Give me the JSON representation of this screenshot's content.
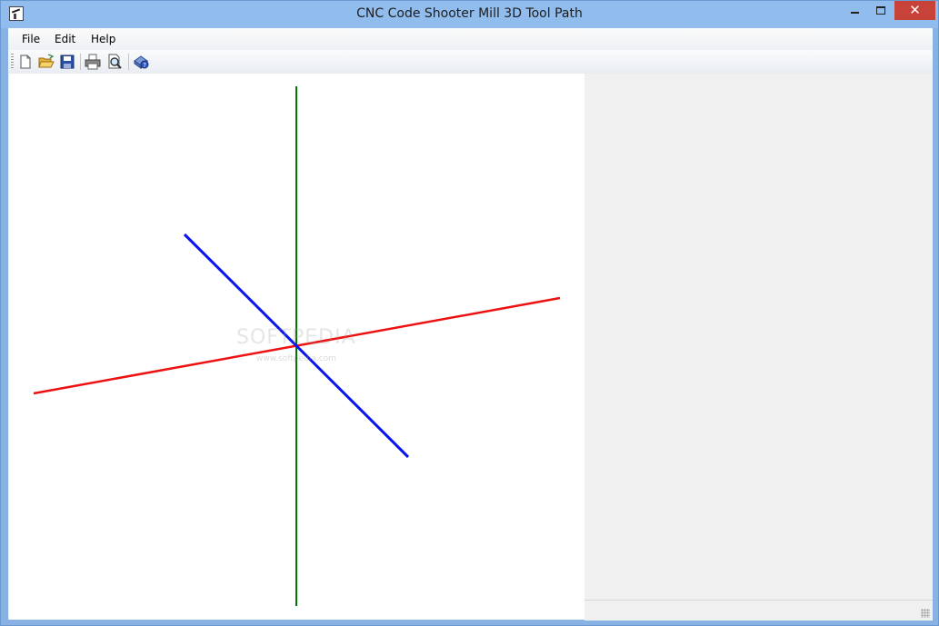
{
  "window": {
    "title": "CNC Code Shooter Mill 3D Tool Path",
    "controls": {
      "minimize": "minimize",
      "maximize": "maximize",
      "close": "✕"
    }
  },
  "menu": [
    {
      "id": "file",
      "label": "File"
    },
    {
      "id": "edit",
      "label": "Edit"
    },
    {
      "id": "help",
      "label": "Help"
    }
  ],
  "toolbar": [
    {
      "id": "new",
      "icon": "new-document-icon"
    },
    {
      "id": "open",
      "icon": "open-folder-icon"
    },
    {
      "id": "save",
      "icon": "save-icon"
    },
    {
      "id": "print",
      "icon": "print-icon"
    },
    {
      "id": "print-preview",
      "icon": "print-preview-icon"
    },
    {
      "id": "about",
      "icon": "help-about-icon"
    }
  ],
  "viewport": {
    "axes": [
      {
        "name": "x-axis",
        "color": "#ee1111"
      },
      {
        "name": "y-axis",
        "color": "#007700"
      },
      {
        "name": "z-axis",
        "color": "#0a14ee"
      }
    ],
    "watermark": "SOFTPEDIA",
    "watermark_url": "www.softpedia.com"
  },
  "status": {
    "text": ""
  }
}
